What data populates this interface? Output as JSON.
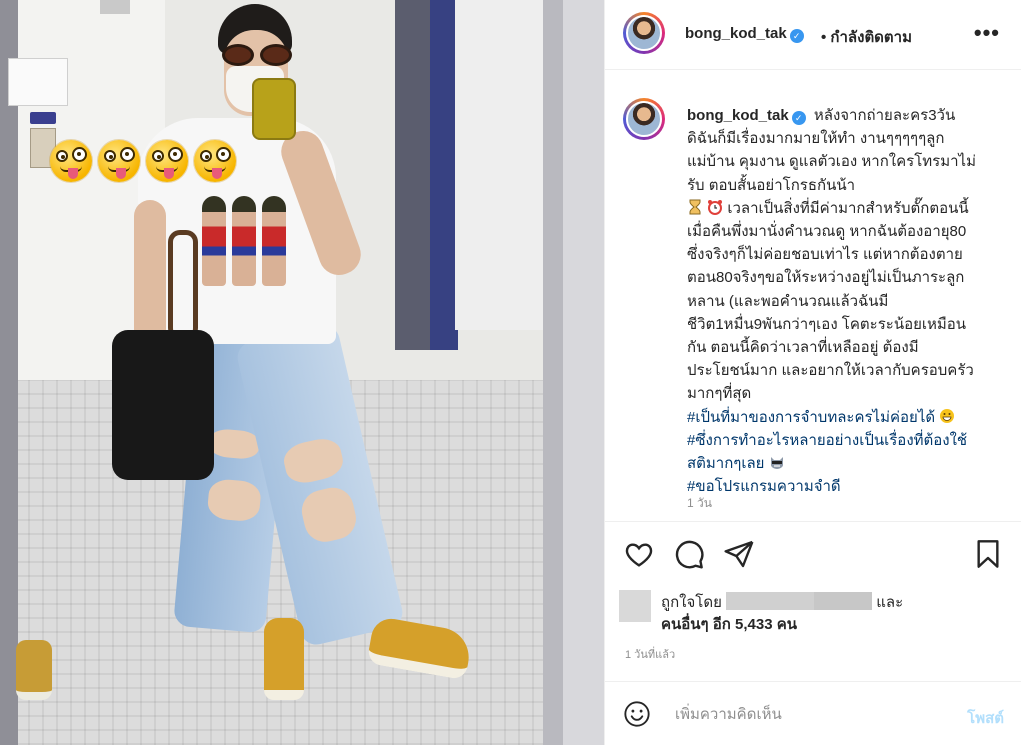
{
  "header": {
    "username": "bong_kod_tak",
    "follow_status": "• กำลังติดตาม",
    "more_icon": "more-horizontal-icon"
  },
  "caption": {
    "username": "bong_kod_tak",
    "lines": [
      "หลังจากถ่ายละคร3วัน",
      "ดิฉันก็มีเรื่องมากมายให้ทำ งานๆๆๆๆๆลูก",
      "แม่บ้าน คุมงาน ดูแลตัวเอง หากใครโทรมาไม่",
      "รับ ตอบสั้นอย่าโกรธกันน้า",
      "เวลาเป็นสิ่งที่มีค่ามากสำหรับตั๊กตอนนี้",
      "เมื่อคืนพึ่งมานั่งคำนวณดู หากฉันต้องอายุ80",
      "ซึ่งจริงๆก็ไม่ค่อยชอบเท่าไร แต่หากต้องตาย",
      "ตอน80จริงๆขอให้ระหว่างอยู่ไม่เป็นภาระลูก",
      "หลาน (และพอคำนวณแล้วฉันมี",
      "ชีวิต1หมื่น9พันกว่าๆเอง โคตะระน้อยเหมือน",
      "กัน ตอนนี้คิดว่าเวลาที่เหลืออยู่ ต้องมี",
      "ประโยชน์มาก และอยากให้เวลากับครอบครัว",
      "มากๆที่สุด"
    ],
    "hashtags": [
      "#เป็นที่มาของการจำบทละครไม่ค่อยได้",
      "#ซึ่งการทำอะไรหลายอย่างเป็นเรื่องที่ต้องใช้",
      "สติมากๆเลย",
      "#ขอโปรแกรมความจำดี"
    ],
    "time": "1 วัน"
  },
  "actions": {
    "like_icon": "heart-icon",
    "comment_icon": "comment-icon",
    "share_icon": "send-icon",
    "save_icon": "bookmark-icon"
  },
  "likes": {
    "prefix": "ถูกใจโดย",
    "suffix": "และ",
    "others": "คนอื่นๆ อีก 5,433 คน"
  },
  "post_time": "1 วันที่แล้ว",
  "comment": {
    "placeholder": "เพิ่มความคิดเห็น",
    "post_label": "โพสต์"
  },
  "colors": {
    "link": "#00376b",
    "verified": "#3897f0",
    "post_button_disabled": "#b2dffc",
    "muted_text": "#8e8e8e"
  }
}
